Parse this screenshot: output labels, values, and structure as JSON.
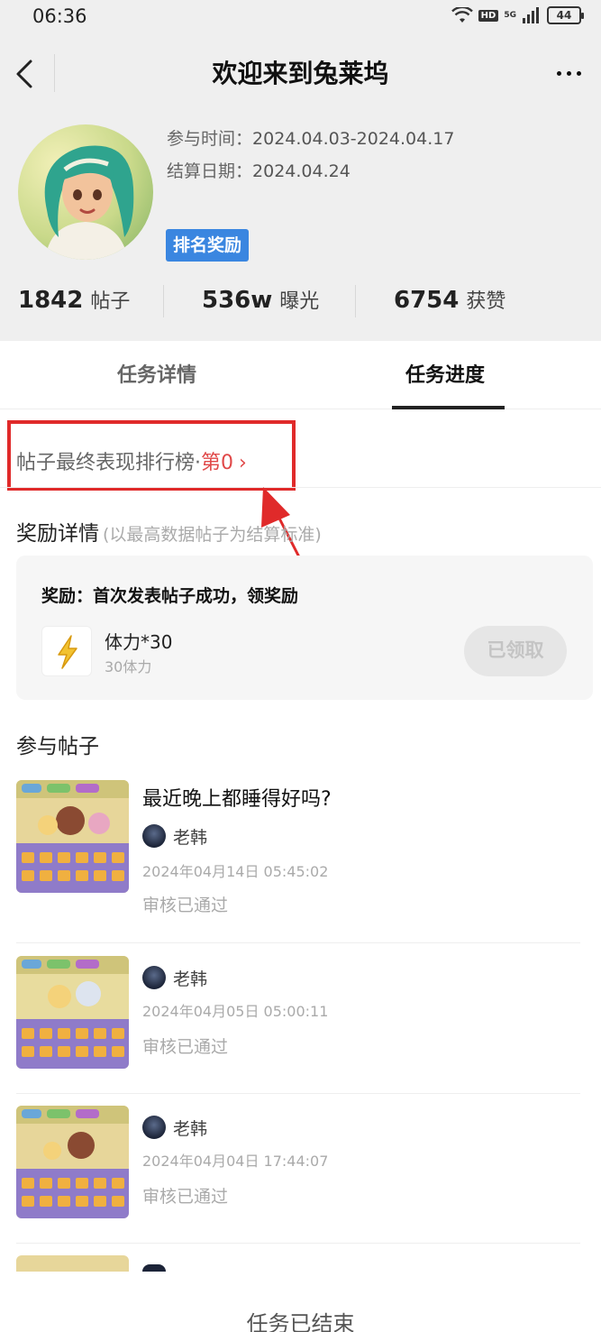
{
  "status_bar": {
    "time": "06:36",
    "hd": "HD",
    "network": "5G",
    "battery": "44"
  },
  "header": {
    "title": "欢迎来到兔莱坞"
  },
  "profile": {
    "join_label": "参与时间：",
    "join_value": "2024.04.03-2024.04.17",
    "settle_label": "结算日期：",
    "settle_value": "2024.04.24",
    "tag": "排名奖励"
  },
  "stats": [
    {
      "value": "1842",
      "unit": "帖子"
    },
    {
      "value": "536w",
      "unit": "曝光"
    },
    {
      "value": "6754",
      "unit": "获赞"
    }
  ],
  "tabs": [
    {
      "label": "任务详情"
    },
    {
      "label": "任务进度"
    }
  ],
  "ranking": {
    "label": "帖子最终表现排行榜·",
    "value": "第0",
    "chevron": "›"
  },
  "reward_section": {
    "title": "奖励详情",
    "hint": "(以最高数据帖子为结算标准)"
  },
  "reward": {
    "title": "奖励：首次发表帖子成功，领奖励",
    "name": "体力*30",
    "sub": "30体力",
    "button": "已领取"
  },
  "posts_section": {
    "title": "参与帖子"
  },
  "posts": [
    {
      "title": "最近晚上都睡得好吗?",
      "user": "老韩",
      "time": "2024年04月14日 05:45:02",
      "status": "审核已通过"
    },
    {
      "title": "",
      "user": "老韩",
      "time": "2024年04月05日 05:00:11",
      "status": "审核已通过"
    },
    {
      "title": "",
      "user": "老韩",
      "time": "2024年04月04日 17:44:07",
      "status": "审核已通过"
    }
  ],
  "footer": {
    "text": "任务已结束"
  },
  "colors": {
    "accent_tag": "#3a86e0",
    "highlight_red": "#e02a2a",
    "rank_red": "#e04848"
  }
}
